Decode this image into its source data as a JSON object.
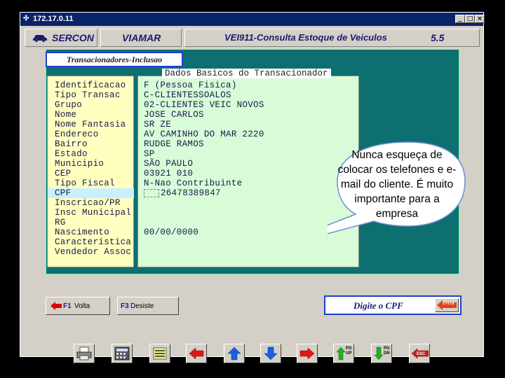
{
  "window": {
    "title": "172.17.0.11",
    "min": "_",
    "max": "□",
    "close": "×"
  },
  "header": {
    "brand": "SERCON",
    "company": "VIAMAR",
    "screen": "VEI911-Consulta Estoque de Veiculos",
    "version": "5.5"
  },
  "tab": {
    "title": "Transacionadores-Inclusao"
  },
  "section": {
    "title": "Dados Basicos do Transacionador"
  },
  "fields": [
    {
      "label": "Identificacao",
      "value": "F  (Pessoa Fisica)"
    },
    {
      "label": "Tipo Transac",
      "value": "C-CLIENTESSOALOS"
    },
    {
      "label": "Grupo",
      "value": "02-CLIENTES VEIC NOVOS"
    },
    {
      "label": "Nome",
      "value": "JOSE CARLOS"
    },
    {
      "label": "Nome Fantasia",
      "value": "SR ZE"
    },
    {
      "label": "Endereco",
      "value": "AV CAMINHO DO MAR 2220"
    },
    {
      "label": "Bairro",
      "value": "RUDGE RAMOS"
    },
    {
      "label": "Estado",
      "value": "SP"
    },
    {
      "label": "Municipio",
      "value": "SÃO PAULO"
    },
    {
      "label": "CEP",
      "value": "03921 010"
    },
    {
      "label": "Tipo Fiscal",
      "value": "N-Nao Contribuinte"
    },
    {
      "label": "CPF",
      "value": "26478389847"
    },
    {
      "label": "Inscricao/PR",
      "value": ""
    },
    {
      "label": "Insc  Municipal",
      "value": ""
    },
    {
      "label": "RG",
      "value": ""
    },
    {
      "label": "Nascimento",
      "value": "00/00/0000"
    },
    {
      "label": "Caracteristica",
      "value": ""
    },
    {
      "label": "Vendedor Assoc",
      "value": ""
    }
  ],
  "callout": {
    "text": "Nunca esqueça de colocar os telefones e e-mail do cliente. É muito importante para a empresa"
  },
  "footer": {
    "volta_key": "F1",
    "volta_label": "Volta",
    "desiste_key": "F3",
    "desiste_label": "Desiste",
    "prompt": "Digite o CPF",
    "enter_label": "ENTER"
  },
  "toolbar": {
    "pgup_label": "PG UP",
    "pgdn_label": "PG DN",
    "esc_label": "ESC"
  },
  "colors": {
    "panel": "#0e6f70",
    "labels_bg": "#ffffc0",
    "values_bg": "#d8fcd8",
    "titlebar": "#0a246a"
  }
}
